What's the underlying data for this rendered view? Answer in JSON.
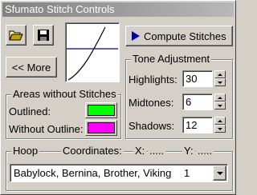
{
  "window": {
    "title": "Sfumato Stitch Controls"
  },
  "toolbar": {
    "open_icon": "folder-open-icon",
    "save_icon": "floppy-save-icon"
  },
  "compute": {
    "label": "Compute Stitches"
  },
  "more": {
    "label": "<< More"
  },
  "areas": {
    "title": "Areas without Stitches",
    "outlined_label": "Outlined:",
    "outlined_color": "#00ff00",
    "without_outline_label": "Without Outline:",
    "without_outline_color": "#ff00ff"
  },
  "tone": {
    "title": "Tone Adjustment",
    "highlights_label": "Highlights:",
    "highlights_value": "30",
    "midtones_label": "Midtones:",
    "midtones_value": "6",
    "shadows_label": "Shadows:",
    "shadows_value": "12"
  },
  "hoop": {
    "title": "Hoop",
    "coords_label": "Coordinates:",
    "x_label": "X:",
    "x_value": ".....",
    "y_label": "Y:",
    "y_value": ".....",
    "selected_brand": "Babylock, Bernina, Brother, Viking",
    "selected_number": "1"
  }
}
